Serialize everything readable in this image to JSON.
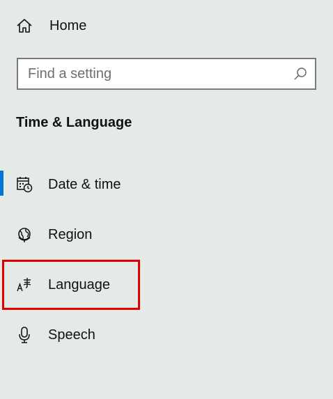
{
  "nav": {
    "home_label": "Home",
    "home_icon": "home-icon"
  },
  "search": {
    "placeholder": "Find a setting",
    "value": "",
    "icon": "search-icon"
  },
  "section": {
    "title": "Time & Language"
  },
  "items": [
    {
      "label": "Date & time",
      "icon": "calendar-clock-icon",
      "selected": true
    },
    {
      "label": "Region",
      "icon": "globe-icon",
      "selected": false
    },
    {
      "label": "Language",
      "icon": "language-icon",
      "selected": false,
      "highlighted": true
    },
    {
      "label": "Speech",
      "icon": "microphone-icon",
      "selected": false
    }
  ],
  "colors": {
    "background": "#e6eae6",
    "accent": "#0078d7",
    "highlight": "#e00000"
  }
}
